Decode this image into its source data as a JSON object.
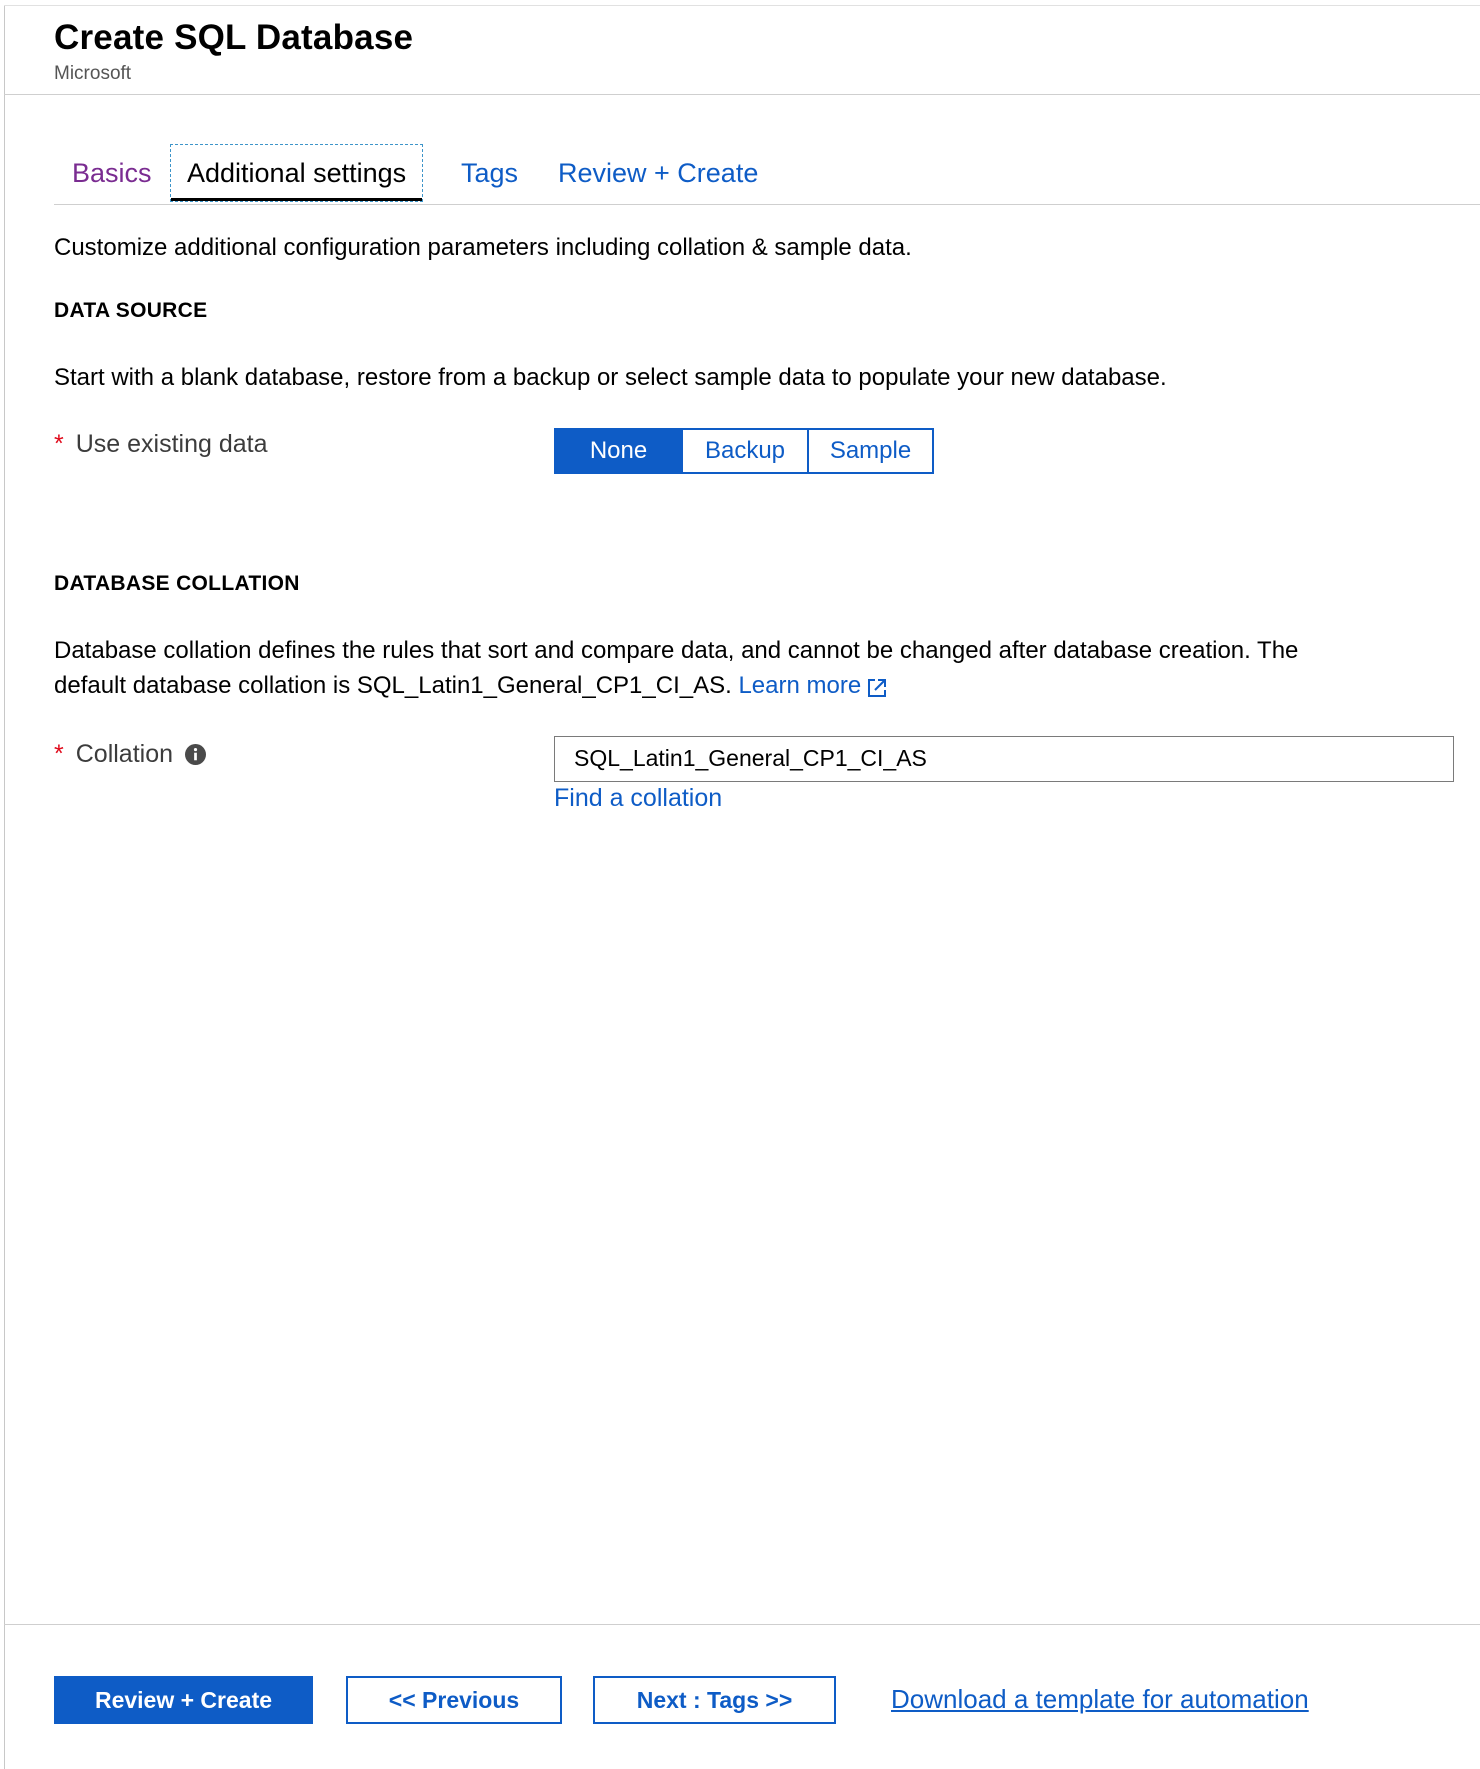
{
  "header": {
    "title": "Create SQL Database",
    "subtitle": "Microsoft"
  },
  "tabs": [
    {
      "label": "Basics",
      "state": "visited"
    },
    {
      "label": "Additional settings",
      "state": "active"
    },
    {
      "label": "Tags",
      "state": "default"
    },
    {
      "label": "Review + Create",
      "state": "default"
    }
  ],
  "page": {
    "description": "Customize additional configuration parameters including collation & sample data."
  },
  "data_source": {
    "heading": "DATA SOURCE",
    "text": "Start with a blank database, restore from a backup or select sample data to populate your new database.",
    "field_label": "Use existing data",
    "required_marker": "*",
    "options": [
      "None",
      "Backup",
      "Sample"
    ],
    "selected": "None"
  },
  "database_collation": {
    "heading": "DATABASE COLLATION",
    "text_line1": "Database collation defines the rules that sort and compare data, and cannot be changed after database creation. The",
    "text_line2": "default database collation is SQL_Latin1_General_CP1_CI_AS.",
    "learn_more": "Learn more",
    "field_label": "Collation",
    "required_marker": "*",
    "value": "SQL_Latin1_General_CP1_CI_AS",
    "find_link": "Find a collation"
  },
  "footer": {
    "review_create": "Review + Create",
    "previous": "<< Previous",
    "next": "Next : Tags >>",
    "download_template": "Download a template for automation"
  },
  "colors": {
    "accent": "#0e5cc6",
    "visited_tab": "#7a2c91",
    "required": "#e00b1c"
  },
  "icons": {
    "info": "info-icon",
    "external_link": "external-link-icon"
  }
}
